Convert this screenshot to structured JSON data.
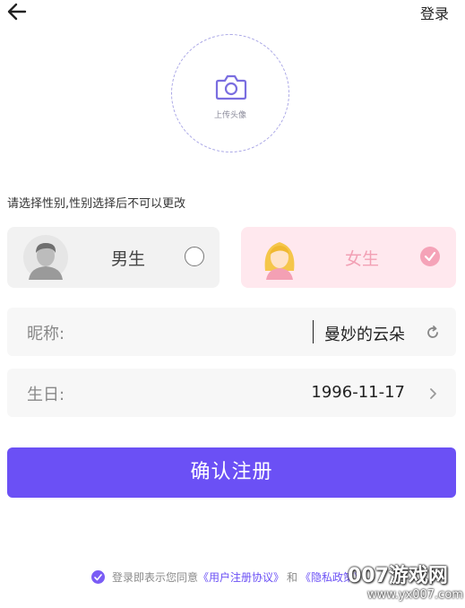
{
  "header": {
    "login_label": "登录"
  },
  "avatar_upload": {
    "label": "上传头像"
  },
  "gender": {
    "hint": "请选择性别,性别选择后不可以更改",
    "male_label": "男生",
    "female_label": "女生",
    "selected": "female"
  },
  "nickname": {
    "label": "昵称:",
    "value": "曼妙的云朵"
  },
  "birthday": {
    "label": "生日:",
    "value": "1996-11-17"
  },
  "submit_label": "确认注册",
  "agreement": {
    "prefix": "登录即表示您同意",
    "user_agreement": "《用户注册协议》",
    "and": "和",
    "privacy": "《隐私政策》"
  },
  "watermark": {
    "logo": "007游戏网",
    "url": "www.yx007.com"
  },
  "colors": {
    "accent": "#6b50f5",
    "female_bg": "#ffe8ee",
    "female_accent": "#f5a3b8"
  }
}
